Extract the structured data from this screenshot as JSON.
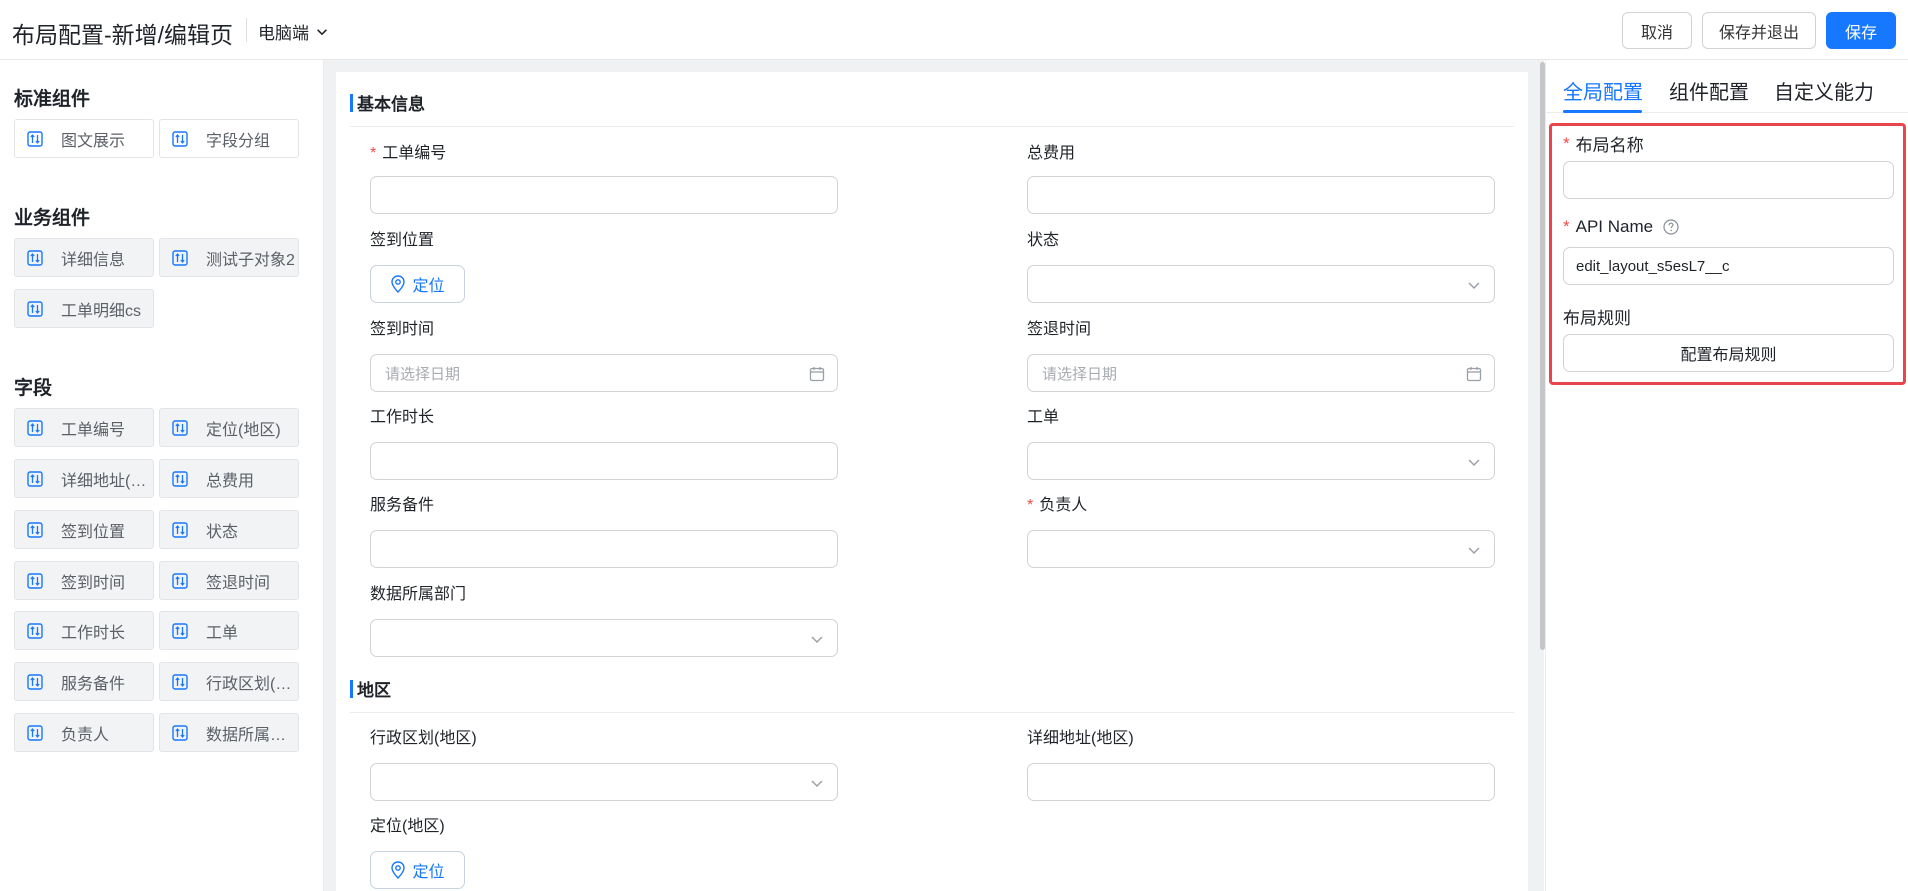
{
  "header": {
    "title": "布局配置-新增/编辑页",
    "device": "电脑端",
    "cancel_label": "取消",
    "save_exit_label": "保存并退出",
    "save_label": "保存"
  },
  "left": {
    "standard_title": "标准组件",
    "standard_items": [
      "图文展示",
      "字段分组"
    ],
    "business_title": "业务组件",
    "business_items": [
      "详细信息",
      "测试子对象2",
      "工单明细cs"
    ],
    "fields_title": "字段",
    "field_items": [
      "工单编号",
      "定位(地区)",
      "详细地址(地...",
      "总费用",
      "签到位置",
      "状态",
      "签到时间",
      "签退时间",
      "工作时长",
      "工单",
      "服务备件",
      "行政区划(地...",
      "负责人",
      "数据所属部门"
    ]
  },
  "canvas": {
    "group1_title": "基本信息",
    "fields": {
      "work_order_no": "工单编号",
      "total_cost": "总费用",
      "checkin_location": "签到位置",
      "status": "状态",
      "checkin_time": "签到时间",
      "checkout_time": "签退时间",
      "work_duration": "工作时长",
      "work_order": "工单",
      "service_parts": "服务备件",
      "owner": "负责人",
      "data_dept": "数据所属部门",
      "admin_region": "行政区划(地区)",
      "detail_address": "详细地址(地区)",
      "location_region": "定位(地区)"
    },
    "locate_label": "定位",
    "date_placeholder": "请选择日期",
    "group2_title": "地区"
  },
  "right": {
    "tabs": [
      "全局配置",
      "组件配置",
      "自定义能力"
    ],
    "layout_name_label": "布局名称",
    "layout_name_value": "",
    "api_name_label": "API Name",
    "api_name_value": "edit_layout_s5esL7__c",
    "layout_rule_label": "布局规则",
    "layout_rule_button": "配置布局规则"
  },
  "colors": {
    "accent": "#1677ff",
    "required": "#f54a45",
    "highlight_border": "#e8464f"
  }
}
